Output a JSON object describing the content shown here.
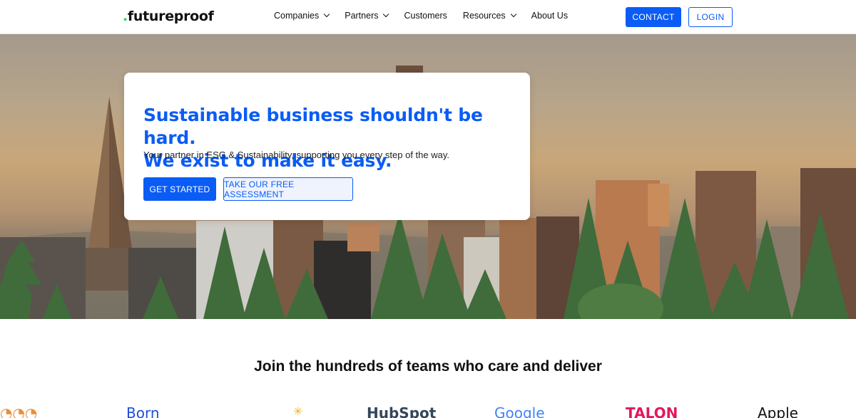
{
  "nav": {
    "logo": ".futureproof",
    "logo_dot": ".",
    "logo_text": "futureproof",
    "menu": [
      {
        "label": "Companies",
        "has_dropdown": true
      },
      {
        "label": "Partners",
        "has_dropdown": true
      },
      {
        "label": "Customers",
        "has_dropdown": false
      },
      {
        "label": "Resources",
        "has_dropdown": true
      },
      {
        "label": "About Us",
        "has_dropdown": false
      }
    ],
    "contact_label": "CONTACT",
    "login_label": "LOGIN"
  },
  "hero": {
    "headline_line1": "Sustainable business shouldn't be hard.",
    "headline_line2": "We exist to make it easy.",
    "subtext": "Your partner in ESG & Sustainability, supporting you every step of the way.",
    "cta_primary": "GET STARTED",
    "cta_secondary": "TAKE OUR FREE ASSESSMENT"
  },
  "customers": {
    "heading": "Join the hundreds of teams who care and deliver",
    "logos": [
      "Born",
      "HubSpot",
      "Google",
      "TALON",
      "Apple"
    ]
  },
  "colors": {
    "brand_blue": "#0a5cf5",
    "logo_dot_green": "#2ecc71"
  }
}
